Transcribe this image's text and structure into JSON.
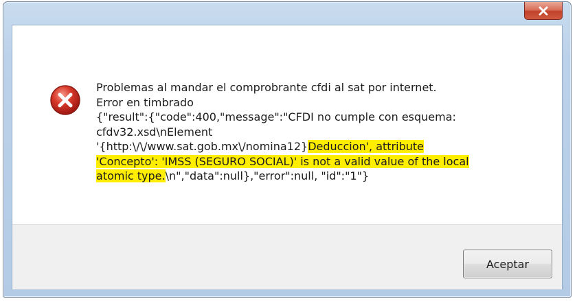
{
  "dialog": {
    "close_icon": "close-icon",
    "error_icon": "error-icon",
    "message": {
      "line1": "Problemas al mandar el comprobrante cfdi al sat por internet.",
      "line2": "Error en timbrado",
      "line3": "{\"result\":{\"code\":400,\"message\":\"CFDI no cumple con esquema:",
      "line4": "cfdv32.xsd\\nElement",
      "line5_plain": "'{http:\\/\\/www.sat.gob.mx\\/nomina12}",
      "line5_highlight": "Deduccion', attribute",
      "line6_highlight": "'Concepto': 'IMSS (SEGURO SOCIAL)' is not a valid value of the local",
      "line7_highlight": "atomic type.",
      "line7_plain": "\\n\",\"data\":null},\"error\":null, \"id\":\"1\"}"
    },
    "highlight_color": "#ffee00",
    "ok_button_label": "Aceptar"
  }
}
